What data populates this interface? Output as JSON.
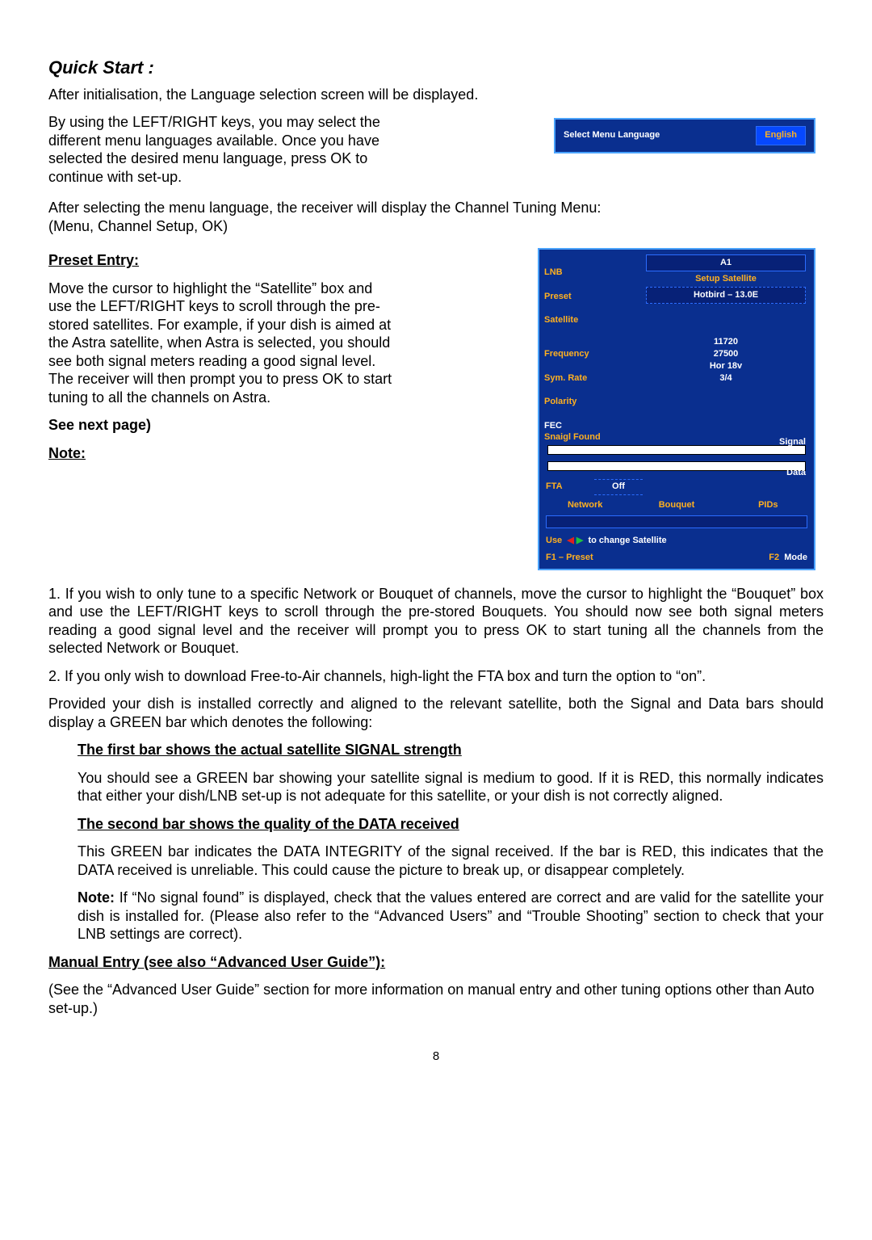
{
  "title": "Quick Start :",
  "intro": "After initialisation, the Language selection screen will be displayed.",
  "lang_para": "By using the LEFT/RIGHT keys, you may select the different menu languages available. Once you have selected the desired menu language, press OK to continue with set-up.",
  "lang_osd": {
    "label": "Select Menu Language",
    "value": "English"
  },
  "after_lang_1": "After selecting the menu language, the receiver will display the Channel Tuning Menu:",
  "after_lang_2": "(Menu, Channel Setup, OK)",
  "preset_heading": "Preset Entry:",
  "preset_para": "Move the cursor to highlight the “Satellite” box and use the LEFT/RIGHT keys to scroll through the pre-stored satellites. For example, if your dish is aimed at the Astra satellite, when Astra is selected, you should see both signal meters reading a good signal level. The receiver will then prompt you to press OK to start tuning to all the channels on Astra.",
  "see_next": "See next page)",
  "note_heading": "Note:",
  "note1": "1. If you wish to only tune to a specific Network or Bouquet of channels, move the cursor to highlight the “Bouquet” box and use the LEFT/RIGHT keys to scroll through the pre-stored Bouquets. You should now see both signal meters reading a good signal level and the receiver will prompt you to press OK to start tuning all the channels from the selected Network or Bouquet.",
  "note2": "2. If you only wish to download Free-to-Air channels, high-light the FTA box and turn the option to “on”.",
  "provided": "Provided your dish is installed correctly and aligned to the relevant satellite, both the Signal and Data bars should display a GREEN bar which denotes the following:",
  "bar1_heading": "The first bar shows the actual satellite SIGNAL strength",
  "bar1_para": "You should see a GREEN bar showing your satellite signal is medium to good. If it is RED, this normally indicates that either your dish/LNB set-up is not adequate for this satellite, or your dish is not correctly aligned.",
  "bar2_heading": "The second bar shows the quality of the DATA received",
  "bar2_para": "This GREEN bar indicates the DATA INTEGRITY of the signal received. If the bar is RED, this indicates that the DATA received is unreliable. This could cause the picture to break up, or disappear completely.",
  "no_signal_note_prefix": "Note:",
  "no_signal_note": " If “No signal found” is displayed, check that the values entered are correct and are valid for the satellite your dish is installed for. (Please also refer to the “Advanced Users” and “Trouble Shooting” section to check that your LNB settings are correct).",
  "manual_heading": "Manual Entry (see also “Advanced User Guide”):",
  "manual_para": "(See the “Advanced User Guide” section for more information on manual entry and other tuning options other than Auto set-up.)",
  "page_number": "8",
  "tune_osd": {
    "lnb_label": "LNB",
    "preset_label": "Preset",
    "satellite_label": "Satellite",
    "lnb_value": "A1",
    "preset_value": "Setup Satellite",
    "satellite_value": "Hotbird – 13.0E",
    "freq_label": "Frequency",
    "sym_label": "Sym. Rate",
    "pol_label": "Polarity",
    "fec_label": "FEC",
    "freq_value": "11720",
    "sym_value": "27500",
    "pol_value": "Hor 18v",
    "fec_value": "3/4",
    "signal_found": "Snaigl Found",
    "signal_label": "Signal",
    "data_label": "Data",
    "fta_label": "FTA",
    "fta_value": "Off",
    "network": "Network",
    "bouquet": "Bouquet",
    "pids": "PIDs",
    "use_label": "Use",
    "use_hint": "to change Satellite",
    "f1": "F1 – Preset",
    "f2_prefix": "F2",
    "f2_mode": "Mode"
  }
}
